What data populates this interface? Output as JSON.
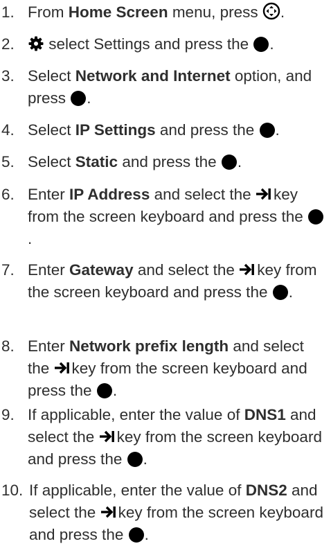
{
  "steps": [
    {
      "num": "1.",
      "t1": "From ",
      "b1": "Home Screen",
      "t2": " menu, press ",
      "icon": "dpad-icon"
    },
    {
      "num": "2.",
      "icon": "gear-icon",
      "t1": " select Settings and press the ",
      "icon2": "ok-button-icon",
      "t2": "."
    },
    {
      "num": "3.",
      "t1": "Select ",
      "b1": "Network and Internet",
      "t2": " option, and press ",
      "icon": "ok-button-icon",
      "t3": "."
    },
    {
      "num": "4.",
      "t1": "Select ",
      "b1": "IP Settings",
      "t2": " and press the ",
      "icon": "ok-button-icon",
      "t3": "."
    },
    {
      "num": "5.",
      "t1": "Select ",
      "b1": "Static",
      "t2": " and press the ",
      "icon": "ok-button-icon",
      "t3": "."
    },
    {
      "num": "6.",
      "t1": "Enter ",
      "b1": "IP Address",
      "t2": " and select the ",
      "icon": "tab-key-icon",
      "t3": "key from the screen keyboard and press the ",
      "icon2": "ok-button-icon",
      "t4": "."
    },
    {
      "num": "7.",
      "t1": "Enter ",
      "b1": "Gateway",
      "t2": " and select the ",
      "icon": "tab-key-icon",
      "t3": "key from the screen keyboard and press the ",
      "icon2": "ok-button-icon",
      "t4": "."
    },
    {
      "num": "8.",
      "t1": "Enter ",
      "b1": "Network prefix length",
      "t2": " and select the ",
      "icon": "tab-key-icon",
      "t3": "key from the screen keyboard and press the ",
      "icon2": "ok-button-icon",
      "t4": "."
    },
    {
      "num": "9.",
      "t1": "If applicable, enter the value of ",
      "b1": "DNS1",
      "t2": " and select the ",
      "icon": "tab-key-icon",
      "t3": "key from the screen keyboard and press the ",
      "icon2": "ok-button-icon",
      "t4": "."
    },
    {
      "num": "10.",
      "t1": "If applicable, enter the value of ",
      "b1": "DNS2",
      "t2": " and select the ",
      "icon": "tab-key-icon",
      "t3": "key from the screen keyboard and press the ",
      "icon2": "ok-button-icon",
      "t4": "."
    }
  ]
}
